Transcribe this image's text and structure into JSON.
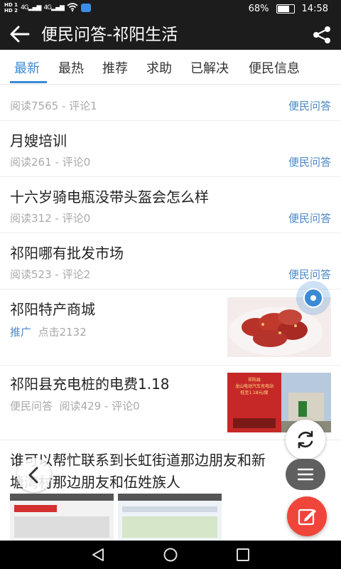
{
  "status": {
    "hd1": "HD 1",
    "hd2": "HD 2",
    "net1": "4G",
    "net2": "4G",
    "battery": "68%",
    "time": "14:58"
  },
  "header": {
    "title": "便民问答-祁阳生活",
    "back_icon": "arrow-left-icon",
    "share_icon": "share-icon"
  },
  "tabs": [
    "最新",
    "最热",
    "推荐",
    "求助",
    "已解决",
    "便民信息"
  ],
  "active_tab": 0,
  "feed": [
    {
      "title": "",
      "meta": "阅读7565 - 评论1",
      "category": "便民问答"
    },
    {
      "title": "月嫂培训",
      "meta": "阅读261 - 评论0",
      "category": "便民问答"
    },
    {
      "title": "十六岁骑电瓶没带头盔会怎么样",
      "meta": "阅读312 - 评论0",
      "category": "便民问答"
    },
    {
      "title": "祁阳哪有批发市场",
      "meta": "阅读523 - 评论2",
      "category": "便民问答"
    },
    {
      "title": "祁阳特产商城",
      "meta_tag": "推广",
      "meta": "点击2132"
    },
    {
      "title": "祁阳县充电桩的电费1.18",
      "meta_tag": "便民问答",
      "meta": "阅读429 - 评论0"
    },
    {
      "title_line1": "谁可以帮忙联系到长虹街道那边朋友和新",
      "title_line2": "塘湾村那边朋友和伍姓族人"
    }
  ],
  "charger_ad": {
    "line1": "祁阳县",
    "line2": "龙山电动汽车充电站",
    "line3": "低至1.18元/度"
  },
  "fab": {
    "refresh_icon": "refresh-icon",
    "menu_icon": "menu-icon",
    "edit_icon": "edit-icon",
    "page_back_icon": "chevron-left-icon"
  },
  "colors": {
    "accent": "#3a8ad6",
    "category": "#4a88c7",
    "meta": "#aaaaaa",
    "header_bg": "#1c1c1c",
    "edit_fab": "#f0453a"
  }
}
